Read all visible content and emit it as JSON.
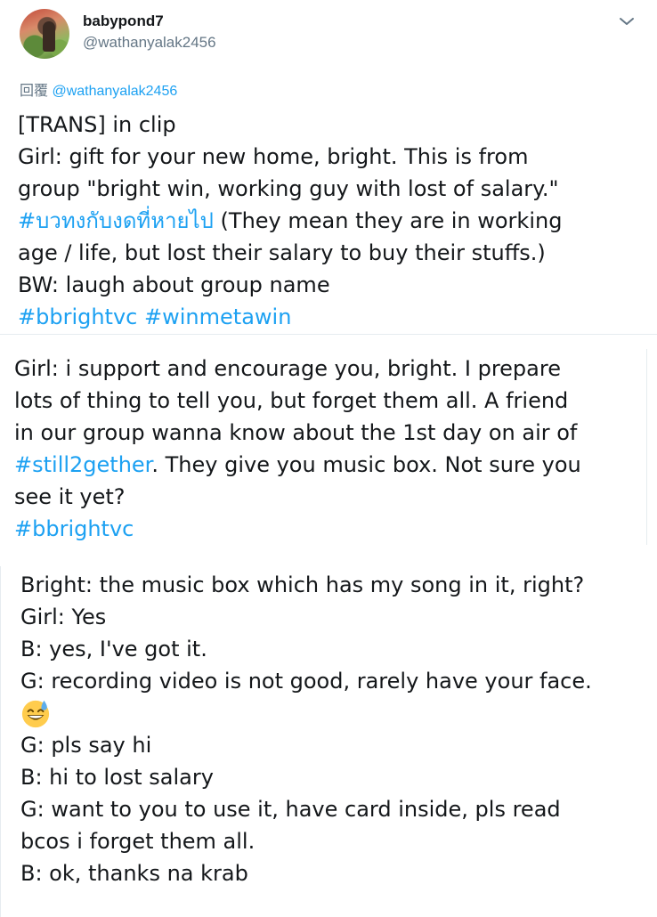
{
  "tweet": {
    "display_name": "babypond7",
    "handle": "@wathanyalak2456",
    "reply_prefix": "回覆",
    "reply_to": "@wathanyalak2456",
    "lines": [
      [
        {
          "t": "[TRANS] in clip"
        }
      ],
      [
        {
          "t": "Girl: gift for your new home, bright. This is from"
        }
      ],
      [
        {
          "t": "group \"bright win, working guy with lost of salary.\""
        }
      ],
      [
        {
          "t": "#บวทงกับงดที่หายไป",
          "tag": true
        },
        {
          "t": " (They mean they are in working"
        }
      ],
      [
        {
          "t": "age / life, but lost their salary to buy their stuffs.)"
        }
      ],
      [
        {
          "t": "BW: laugh about group name"
        }
      ],
      [
        {
          "t": "#bbrightvc",
          "tag": true
        },
        {
          "t": " "
        },
        {
          "t": "#winmetawin",
          "tag": true
        }
      ]
    ]
  },
  "block2": {
    "lines": [
      [
        {
          "t": "Girl: i support and encourage you,  bright. I prepare"
        }
      ],
      [
        {
          "t": "lots of thing to tell you, but forget them all. A friend"
        }
      ],
      [
        {
          "t": "in our group wanna know about the 1st day on air of"
        }
      ],
      [
        {
          "t": "#still2gether",
          "tag": true
        },
        {
          "t": ". They give you music box. Not sure you"
        }
      ],
      [
        {
          "t": "see it yet?"
        }
      ],
      [
        {
          "t": "#bbrightvc",
          "tag": true
        }
      ]
    ]
  },
  "block3": {
    "lines": [
      [
        {
          "t": "Bright: the music box which has my song in it, right?"
        }
      ],
      [
        {
          "t": "Girl: Yes"
        }
      ],
      [
        {
          "t": "B: yes, I've got it."
        }
      ],
      [
        {
          "t": "G: recording video is not good, rarely have your face."
        }
      ],
      [
        {
          "emoji": "grinning-sweat-emoji"
        }
      ],
      [
        {
          "t": "G: pls say hi"
        }
      ],
      [
        {
          "t": "B: hi to lost salary"
        }
      ],
      [
        {
          "t": "G: want to you to use it, have card inside, pls read"
        }
      ],
      [
        {
          "t": "bcos i forget them all."
        }
      ],
      [
        {
          "t": "B: ok, thanks na krab"
        }
      ]
    ]
  },
  "colors": {
    "link": "#1da1f2",
    "secondary_text": "#657786",
    "primary_text": "#14171a",
    "divider": "#e6ecf0"
  },
  "icons": {
    "more": "chevron-down-icon",
    "emoji": "grinning-face-with-sweat-emoji"
  }
}
